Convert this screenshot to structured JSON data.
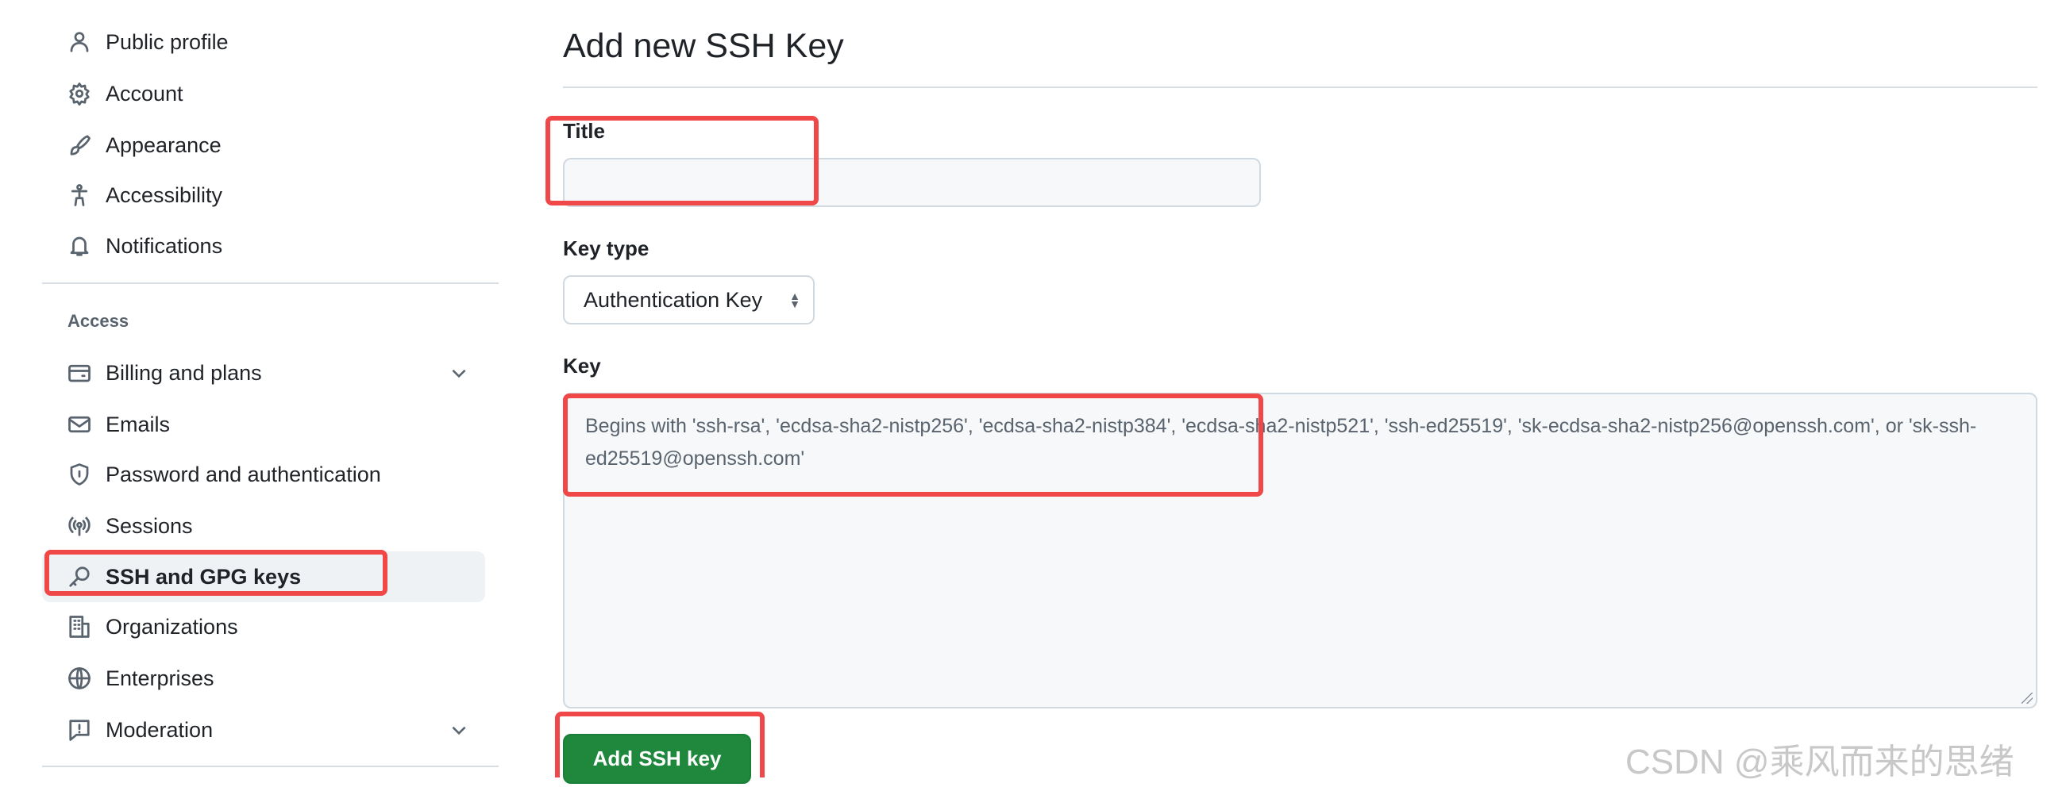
{
  "sidebar": {
    "items": [
      {
        "label": "Public profile",
        "icon": "person-icon"
      },
      {
        "label": "Account",
        "icon": "gear-icon"
      },
      {
        "label": "Appearance",
        "icon": "paintbrush-icon"
      },
      {
        "label": "Accessibility",
        "icon": "accessibility-icon"
      },
      {
        "label": "Notifications",
        "icon": "bell-icon"
      }
    ],
    "section_heading": "Access",
    "access_items": [
      {
        "label": "Billing and plans",
        "icon": "credit-card-icon",
        "expandable": true
      },
      {
        "label": "Emails",
        "icon": "mail-icon"
      },
      {
        "label": "Password and authentication",
        "icon": "shield-lock-icon"
      },
      {
        "label": "Sessions",
        "icon": "broadcast-icon"
      },
      {
        "label": "SSH and GPG keys",
        "icon": "key-icon",
        "active": true
      },
      {
        "label": "Organizations",
        "icon": "organization-icon"
      },
      {
        "label": "Enterprises",
        "icon": "globe-icon"
      },
      {
        "label": "Moderation",
        "icon": "report-icon",
        "expandable": true
      }
    ]
  },
  "main": {
    "title": "Add new SSH Key",
    "title_field": {
      "label": "Title",
      "value": ""
    },
    "key_type": {
      "label": "Key type",
      "selected": "Authentication Key"
    },
    "key_field": {
      "label": "Key",
      "placeholder": "Begins with 'ssh-rsa', 'ecdsa-sha2-nistp256', 'ecdsa-sha2-nistp384', 'ecdsa-sha2-nistp521', 'ssh-ed25519', 'sk-ecdsa-sha2-nistp256@openssh.com', or 'sk-ssh-ed25519@openssh.com'"
    },
    "submit_label": "Add SSH key"
  },
  "colors": {
    "primary_button": "#1f883d",
    "annotation_highlight": "#f04848"
  },
  "watermark": "CSDN @乘风而来的思绪"
}
